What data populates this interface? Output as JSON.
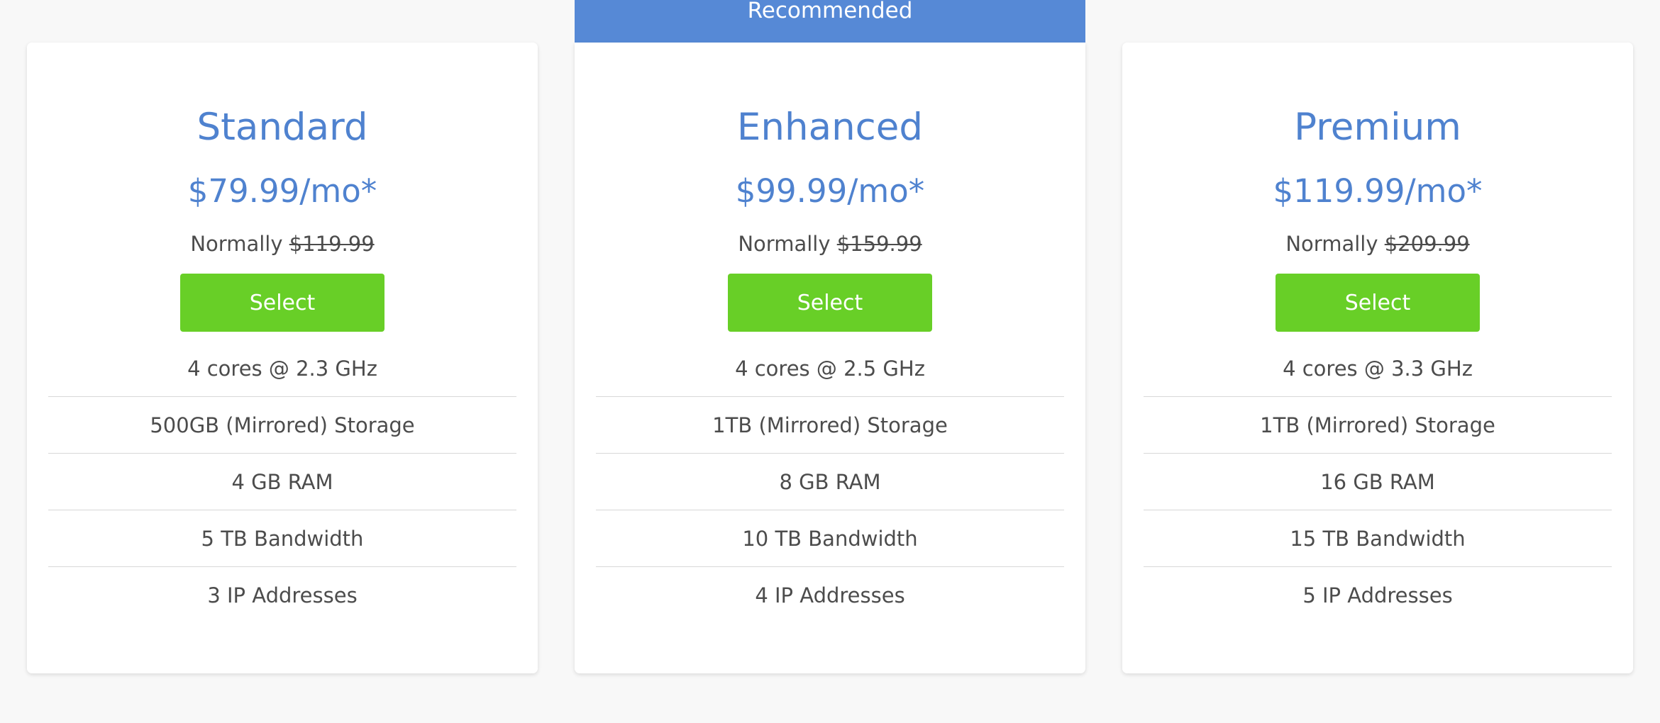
{
  "recommended_label": "Recommended",
  "plans": [
    {
      "name": "Standard",
      "price": "$79.99/mo*",
      "normally_label": "Normally",
      "normal_price": "$119.99",
      "select_label": "Select",
      "features": [
        "4 cores @ 2.3 GHz",
        "500GB (Mirrored) Storage",
        "4 GB RAM",
        "5 TB Bandwidth",
        "3 IP Addresses"
      ]
    },
    {
      "name": "Enhanced",
      "price": "$99.99/mo*",
      "normally_label": "Normally",
      "normal_price": "$159.99",
      "select_label": "Select",
      "features": [
        "4 cores @ 2.5 GHz",
        "1TB (Mirrored) Storage",
        "8 GB RAM",
        "10 TB Bandwidth",
        "4 IP Addresses"
      ]
    },
    {
      "name": "Premium",
      "price": "$119.99/mo*",
      "normally_label": "Normally",
      "normal_price": "$209.99",
      "select_label": "Select",
      "features": [
        "4 cores @ 3.3 GHz",
        "1TB (Mirrored) Storage",
        "16 GB RAM",
        "15 TB Bandwidth",
        "5 IP Addresses"
      ]
    }
  ],
  "colors": {
    "accent_blue": "#4f82cf",
    "banner_blue": "#5689d6",
    "select_green": "#68cf27",
    "text_gray": "#4c4c4c",
    "background": "#f8f8f8"
  }
}
